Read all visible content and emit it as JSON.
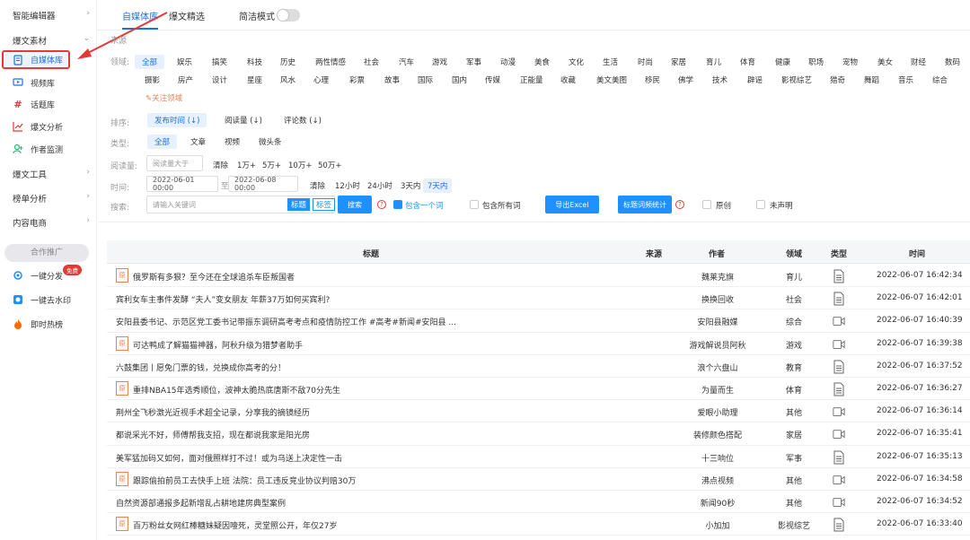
{
  "sidebar": {
    "groups": [
      {
        "label": "智能编辑器",
        "chev": "›"
      },
      {
        "label": "爆文素材",
        "chev": "⌄"
      },
      {
        "label": "爆文工具",
        "chev": "›"
      },
      {
        "label": "榜单分析",
        "chev": "›"
      },
      {
        "label": "内容电商",
        "chev": "›"
      }
    ],
    "items": [
      {
        "label": "自媒体库"
      },
      {
        "label": "视频库"
      },
      {
        "label": "话题库"
      },
      {
        "label": "爆文分析"
      },
      {
        "label": "作者监测"
      }
    ],
    "promo": "合作推广",
    "promo_items": [
      {
        "label": "一键分发"
      },
      {
        "label": "一键去水印"
      },
      {
        "label": "即时热榜"
      }
    ],
    "free_badge": "免费"
  },
  "tabs": [
    {
      "label": "自媒体库"
    },
    {
      "label": "爆文精选"
    },
    {
      "label": "简洁模式"
    }
  ],
  "filters": {
    "source_label": "来源",
    "domain_label": "领域:",
    "domains_row1": [
      "全部",
      "娱乐",
      "搞笑",
      "科技",
      "历史",
      "两性情感",
      "社会",
      "汽车",
      "游戏",
      "军事",
      "动漫",
      "美食",
      "文化",
      "生活",
      "时尚",
      "家居",
      "育儿",
      "体育",
      "健康",
      "职场",
      "宠物",
      "美女",
      "财经",
      "数码"
    ],
    "domains_row2": [
      "摄影",
      "房产",
      "设计",
      "星座",
      "风水",
      "心理",
      "彩票",
      "故事",
      "国际",
      "国内",
      "传媒",
      "正能量",
      "收藏",
      "美文美图",
      "移民",
      "佛学",
      "技术",
      "辟谣",
      "影视综艺",
      "猎奇",
      "舞蹈",
      "音乐",
      "综合"
    ],
    "follow_domain": "关注领域",
    "sort_label": "排序:",
    "sort_opts": [
      "发布时间 (↓)",
      "阅读量 (↓)",
      "评论数 (↓)"
    ],
    "type_label": "类型:",
    "type_opts": [
      "全部",
      "文章",
      "视频",
      "微头条"
    ],
    "reads_label": "阅读量:",
    "reads_placeholder": "阅读量大于",
    "reads_opts": [
      "清除",
      "1万+",
      "5万+",
      "10万+",
      "50万+"
    ],
    "time_label": "时间:",
    "time_start": "2022-06-01 00:00",
    "time_to": "至",
    "time_end": "2022-06-08 00:00",
    "time_opts": [
      "清除",
      "12小时",
      "24小时",
      "3天内",
      "7天内"
    ],
    "search_label": "搜索:",
    "search_placeholder": "请输入关键词",
    "search_mode": [
      "标题",
      "标签"
    ],
    "search_btn": "搜索",
    "contains_one": "包含一个词",
    "contains_all": "包含所有词",
    "export_btn": "导出Excel",
    "stats_btn": "标题词频统计",
    "original": "原创",
    "undeclared": "未声明"
  },
  "table": {
    "headers": [
      "标题",
      "来源",
      "作者",
      "领域",
      "类型",
      "时间"
    ],
    "rows": [
      {
        "orig": true,
        "title": "俄罗斯有多狠？至今还在全球追杀车臣叛国者",
        "author": "魏莱克旗",
        "domain": "育儿",
        "type": "doc",
        "time": "2022-06-07 16:42:34"
      },
      {
        "orig": false,
        "title": "宾利女车主事件发酵 “夫人”变女朋友 年薪37万如何买宾利?",
        "author": "换换回收",
        "domain": "社会",
        "type": "doc",
        "time": "2022-06-07 16:42:01"
      },
      {
        "orig": false,
        "title": "安阳县委书记、示范区党工委书记带振东调研高考考点和疫情防控工作 #高考#新闻#安阳县 ...",
        "author": "安阳县融媒",
        "domain": "综合",
        "type": "vid",
        "time": "2022-06-07 16:40:39"
      },
      {
        "orig": true,
        "title": "可达鸭成了解猫猫神器，阿秋升级为猎梦者助手",
        "author": "游戏解说员阿秋",
        "domain": "游戏",
        "type": "vid",
        "time": "2022-06-07 16:39:38"
      },
      {
        "orig": false,
        "title": "六鼓集团丨愿免门票的钱，兑换成你高考的分！",
        "author": "浪个六盘山",
        "domain": "教育",
        "type": "doc",
        "time": "2022-06-07 16:37:52"
      },
      {
        "orig": true,
        "title": "重排NBA15年选秀顺位，波神太脆热底唐斯不敌70分先生",
        "author": "为量而生",
        "domain": "体育",
        "type": "doc",
        "time": "2022-06-07 16:36:27"
      },
      {
        "orig": false,
        "title": "荆州全飞秒激光近视手术超全记录，分享我的摘镜经历",
        "author": "爱眼小助理",
        "domain": "其他",
        "type": "vid",
        "time": "2022-06-07 16:36:14"
      },
      {
        "orig": false,
        "title": "都说采光不好，师傅帮我支招，现在都说我家是阳光房",
        "author": "装修颜色搭配",
        "domain": "家居",
        "type": "vid",
        "time": "2022-06-07 16:35:41"
      },
      {
        "orig": false,
        "title": "美军猛加码又如何，面对俄照样打不过！或为乌送上决定性一击",
        "author": "十三响位",
        "domain": "军事",
        "type": "doc",
        "time": "2022-06-07 16:35:13"
      },
      {
        "orig": true,
        "title": "跟踪偷拍前员工去快手上班 法院：员工违反竞业协议判赔30万",
        "author": "沸点视频",
        "domain": "其他",
        "type": "vid",
        "time": "2022-06-07 16:34:58"
      },
      {
        "orig": false,
        "title": "自然资源部通报多起新增乱占耕地建房典型案例",
        "author": "新闻90秒",
        "domain": "其他",
        "type": "vid",
        "time": "2022-06-07 16:34:52"
      },
      {
        "orig": true,
        "title": "百万粉丝女网红棒糖妹疑因噎死，灵堂照公开，年仅27岁",
        "author": "小加加",
        "domain": "影视综艺",
        "type": "doc",
        "time": "2022-06-07 16:33:40"
      }
    ],
    "orig_label": "原"
  }
}
